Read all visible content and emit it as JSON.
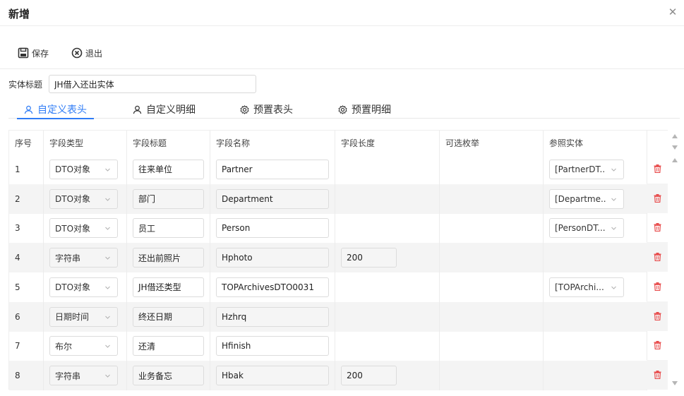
{
  "modal": {
    "title": "新增",
    "close_icon": "close-icon"
  },
  "toolbar": {
    "save_label": "保存",
    "exit_label": "退出",
    "save_icon": "floppy-disk-icon",
    "exit_icon": "circle-x-icon"
  },
  "entity": {
    "label": "实体标题",
    "value": "JH借入还出实体"
  },
  "tabs": [
    {
      "label": "自定义表头",
      "icon": "user-icon",
      "active": true
    },
    {
      "label": "自定义明细",
      "icon": "user-icon",
      "active": false
    },
    {
      "label": "预置表头",
      "icon": "gear-icon",
      "active": false
    },
    {
      "label": "预置明细",
      "icon": "gear-icon",
      "active": false
    }
  ],
  "columns": [
    "序号",
    "字段类型",
    "字段标题",
    "字段名称",
    "字段长度",
    "可选枚举",
    "参照实体"
  ],
  "rows": [
    {
      "idx": "1",
      "type": "DTO对象",
      "label": "往来单位",
      "name": "Partner",
      "length": "",
      "enum": "",
      "ref": "[PartnerDT..."
    },
    {
      "idx": "2",
      "type": "DTO对象",
      "label": "部门",
      "name": "Department",
      "length": "",
      "enum": "",
      "ref": "[Departme..."
    },
    {
      "idx": "3",
      "type": "DTO对象",
      "label": "员工",
      "name": "Person",
      "length": "",
      "enum": "",
      "ref": "[PersonDT..."
    },
    {
      "idx": "4",
      "type": "字符串",
      "label": "还出前照片",
      "name": "Hphoto",
      "length": "200",
      "enum": "",
      "ref": ""
    },
    {
      "idx": "5",
      "type": "DTO对象",
      "label": "JH借还类型",
      "name": "TOPArchivesDTO0031",
      "length": "",
      "enum": "",
      "ref": "[TOPArchi..."
    },
    {
      "idx": "6",
      "type": "日期时间",
      "label": "终还日期",
      "name": "Hzhrq",
      "length": "",
      "enum": "",
      "ref": ""
    },
    {
      "idx": "7",
      "type": "布尔",
      "label": "还清",
      "name": "Hfinish",
      "length": "",
      "enum": "",
      "ref": ""
    },
    {
      "idx": "8",
      "type": "字符串",
      "label": "业务备忘",
      "name": "Hbak",
      "length": "200",
      "enum": "",
      "ref": ""
    }
  ],
  "colors": {
    "accent": "#2f7cf6",
    "delete": "#e84c4c"
  }
}
